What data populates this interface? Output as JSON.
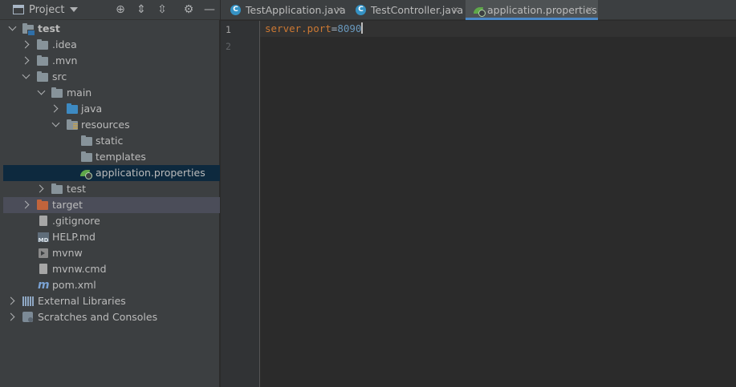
{
  "project_panel": {
    "title": "Project",
    "icons": [
      "locate-icon",
      "expand-all-icon",
      "collapse-all-icon",
      "settings-icon",
      "hide-icon"
    ]
  },
  "tree": {
    "root": "test",
    "idea": ".idea",
    "mvn": ".mvn",
    "src": "src",
    "main": "main",
    "java": "java",
    "resources": "resources",
    "static": "static",
    "templates": "templates",
    "application_properties": "application.properties",
    "test": "test",
    "target": "target",
    "gitignore": ".gitignore",
    "help_md": "HELP.md",
    "mvnw": "mvnw",
    "mvnw_cmd": "mvnw.cmd",
    "pom_xml": "pom.xml",
    "external_libraries": "External Libraries",
    "scratches": "Scratches and Consoles"
  },
  "tabs": [
    {
      "label": "TestApplication.java",
      "active": false
    },
    {
      "label": "TestController.java",
      "active": false
    },
    {
      "label": "application.properties",
      "active": true
    }
  ],
  "editor": {
    "line_numbers": [
      "1",
      "2"
    ],
    "key": "server.port",
    "eq": "=",
    "value": "8090"
  },
  "colors": {
    "key": "#cc7832",
    "number": "#6897bb",
    "selection": "#0d293e",
    "excluded_folder": "#c0643c"
  }
}
